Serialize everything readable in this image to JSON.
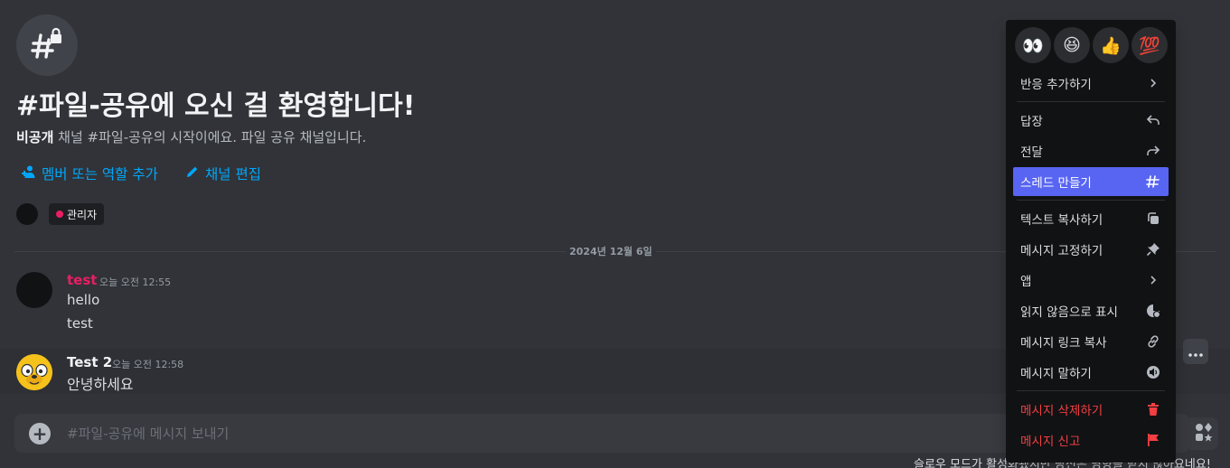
{
  "welcome": {
    "title": "#파일-공유에 오신 걸 환영합니다!",
    "sub_bold": "비공개",
    "sub_rest": " 채널 #파일-공유의 시작이에요. 파일 공유 채널입니다.",
    "add_members": "멤버 또는 역할 추가",
    "edit_channel": "채널 편집",
    "role_label": "관리자",
    "role_color": "#e91e63"
  },
  "date_divider": "2024년 12월 6일",
  "messages": [
    {
      "author": "test",
      "author_color": "#e91e63",
      "time": "오늘 오전 12:55",
      "lines": [
        "hello",
        "test"
      ]
    },
    {
      "author": "Test 2",
      "author_color": "#f2f3f5",
      "time": "오늘 오전 12:58",
      "lines": [
        "안녕하세요"
      ]
    }
  ],
  "composer": {
    "placeholder": "#파일-공유에 메시지 보내기"
  },
  "slowmode_text": "슬로우 모드가 활성화됐지만 당신은 영향을 받지 않아요네요!",
  "context_menu": {
    "emojis": [
      "👀",
      "😆",
      "👍",
      "💯"
    ],
    "groups": [
      [
        {
          "label": "반응 추가하기",
          "icon": "chevron-right-icon"
        }
      ],
      [
        {
          "label": "답장",
          "icon": "reply-icon"
        },
        {
          "label": "전달",
          "icon": "forward-icon"
        },
        {
          "label": "스레드 만들기",
          "icon": "thread-icon",
          "active": true
        }
      ],
      [
        {
          "label": "텍스트 복사하기",
          "icon": "copy-icon"
        },
        {
          "label": "메시지 고정하기",
          "icon": "pin-icon"
        },
        {
          "label": "앱",
          "icon": "chevron-right-icon"
        },
        {
          "label": "읽지 않음으로 표시",
          "icon": "unread-icon"
        },
        {
          "label": "메시지 링크 복사",
          "icon": "link-icon"
        },
        {
          "label": "메시지 말하기",
          "icon": "speak-icon"
        }
      ],
      [
        {
          "label": "메시지 삭제하기",
          "icon": "trash-icon",
          "danger": true
        },
        {
          "label": "메시지 신고",
          "icon": "flag-icon",
          "danger": true
        }
      ]
    ]
  },
  "colors": {
    "background": "#313338",
    "link": "#00a8fc",
    "menu_active": "#5865f2",
    "danger": "#f23f42"
  }
}
